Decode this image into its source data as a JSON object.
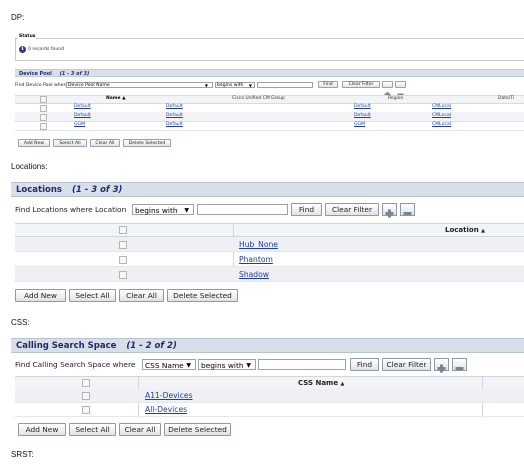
{
  "labels": {
    "dp": "DP:",
    "locations": "Locations:",
    "css": "CSS:",
    "srst": "SRST:"
  },
  "status": {
    "legend": "Status",
    "message": "0 records found"
  },
  "device_pool": {
    "title": "Device Pool",
    "count": "(1 - 3 of 3)",
    "find_prefix": "Find Device Pool where",
    "field": "Device Pool Name",
    "operator": "begins with",
    "find_btn": "Find",
    "clear_filter_btn": "Clear Filter",
    "columns": {
      "name": "Name",
      "cucm_group": "Cisco Unified CM Group",
      "region": "Region",
      "datetime": "Date/Ti"
    },
    "sort_marker": "▲",
    "rows": [
      {
        "name": "Default",
        "group": "Default",
        "region": "Default",
        "dt": "CMLocal"
      },
      {
        "name": "Default",
        "group": "Default",
        "region": "Default",
        "dt": "CMLocal"
      },
      {
        "name": "GGM",
        "group": "Default",
        "region": "GGM",
        "dt": "CMLocal"
      }
    ],
    "actions": {
      "add_new": "Add New",
      "select_all": "Select All",
      "clear_all": "Clear All",
      "delete_selected": "Delete Selected"
    }
  },
  "locations": {
    "title": "Locations",
    "count": "(1 - 3 of 3)",
    "find_prefix": "Find Locations where Location",
    "operator": "begins with",
    "find_btn": "Find",
    "clear_filter_btn": "Clear Filter",
    "column": "Location",
    "sort_marker": "▲",
    "rows": [
      "Hub_None",
      "Phantom",
      "Shadow"
    ],
    "actions": {
      "add_new": "Add New",
      "select_all": "Select All",
      "clear_all": "Clear All",
      "delete_selected": "Delete Selected"
    }
  },
  "css": {
    "title": "Calling Search Space",
    "count": "(1 - 2 of 2)",
    "find_prefix": "Find Calling Search Space where",
    "field": "CSS Name",
    "operator": "begins with",
    "find_btn": "Find",
    "clear_filter_btn": "Clear Filter",
    "column": "CSS Name",
    "sort_marker": "▲",
    "rows": [
      "A11-Devices",
      "All-Devices"
    ],
    "actions": {
      "add_new": "Add New",
      "select_all": "Select All",
      "clear_all": "Clear All",
      "delete_selected": "Delete Selected"
    }
  },
  "icons": {
    "info": "info-icon",
    "add_criteria": "plus-icon",
    "remove_criteria": "minus-icon",
    "dropdown": "chevron-down-icon"
  },
  "colors": {
    "header_bg": "#d8dfe8",
    "header_text": "#1f2a6a",
    "link": "#1f3fa8",
    "alt_row": "#eef0f3"
  }
}
